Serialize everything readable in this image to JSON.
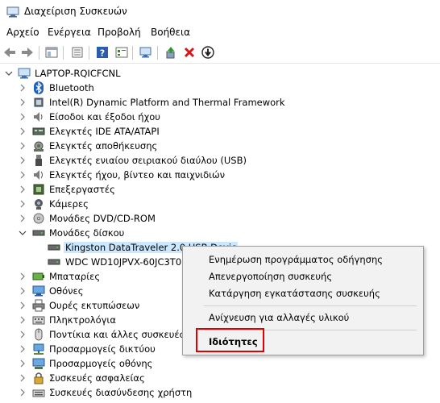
{
  "window": {
    "title": "Διαχείριση Συσκευών"
  },
  "menu": [
    "Αρχείο",
    "Ενέργεια",
    "Προβολή",
    "Βοήθεια"
  ],
  "toolbar": {
    "buttons": [
      "back-icon",
      "forward-icon",
      "show-hide-tree-icon",
      "properties-icon",
      "help-icon",
      "view-icon",
      "scan-hardware-icon",
      "update-driver-icon",
      "uninstall-icon",
      "disable-icon"
    ]
  },
  "tree": {
    "root": "LAPTOP-RQICFCNL",
    "items": [
      {
        "label": "Bluetooth",
        "icon": "bluetooth-icon"
      },
      {
        "label": "Intel(R) Dynamic Platform and Thermal Framework",
        "icon": "chip-icon"
      },
      {
        "label": "Είσοδοι και έξοδοι ήχου",
        "icon": "speaker-icon"
      },
      {
        "label": "Ελεγκτές IDE ATA/ATAPI",
        "icon": "ide-controller-icon"
      },
      {
        "label": "Ελεγκτές αποθήκευσης",
        "icon": "storage-controller-icon"
      },
      {
        "label": "Ελεγκτές ενιαίου σειριακού διαύλου (USB)",
        "icon": "usb-icon"
      },
      {
        "label": "Ελεγκτές ήχου, βίντεο και παιχνιδιών",
        "icon": "sound-icon"
      },
      {
        "label": "Επεξεργαστές",
        "icon": "processor-icon"
      },
      {
        "label": "Κάμερες",
        "icon": "camera-icon"
      },
      {
        "label": "Μονάδες DVD/CD-ROM",
        "icon": "dvd-icon"
      },
      {
        "label": "Μονάδες δίσκου",
        "icon": "disk-drive-icon"
      },
      {
        "label": "Kingston DataTraveler 2.0 USB Devic",
        "icon": "disk-icon"
      },
      {
        "label": "WDC WD10JPVX-60JC3T0",
        "icon": "disk-icon"
      },
      {
        "label": "Μπαταρίες",
        "icon": "battery-icon"
      },
      {
        "label": "Οθόνες",
        "icon": "monitor-icon"
      },
      {
        "label": "Ουρές εκτυπώσεων",
        "icon": "printer-icon"
      },
      {
        "label": "Πληκτρολόγια",
        "icon": "keyboard-icon"
      },
      {
        "label": "Ποντίκια και άλλες συσκευές κ",
        "icon": "mouse-icon"
      },
      {
        "label": "Προσαρμογείς δικτύου",
        "icon": "network-icon"
      },
      {
        "label": "Προσαρμογείς οθόνης",
        "icon": "display-adapter-icon"
      },
      {
        "label": "Συσκευές ασφαλείας",
        "icon": "security-icon"
      },
      {
        "label": "Συσκευές διασύνδεσης χρήστη",
        "icon": "hid-icon"
      }
    ]
  },
  "context_menu": {
    "items": [
      "Ενημέρωση προγράμματος οδήγησης",
      "Απενεργοποίηση συσκευής",
      "Κατάργηση εγκατάστασης συσκευής",
      "Ανίχνευση για αλλαγές υλικού",
      "Ιδιότητες"
    ]
  },
  "colors": {
    "selection": "#cce8ff",
    "highlight_border": "#e00000",
    "menu_bg": "#f2f2f2"
  }
}
